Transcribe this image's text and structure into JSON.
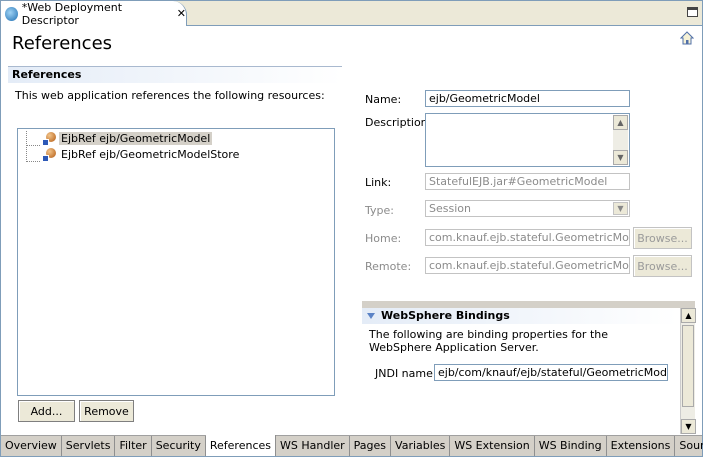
{
  "editor_tab": {
    "title": "*Web Deployment Descriptor",
    "close": "✕"
  },
  "page": {
    "title": "References"
  },
  "references_section": {
    "header": "References",
    "description": "This web application references the following resources:",
    "items": [
      {
        "label": "EjbRef ejb/GeometricModel",
        "selected": true
      },
      {
        "label": "EjbRef ejb/GeometricModelStore",
        "selected": false
      }
    ],
    "add_label": "Add...",
    "remove_label": "Remove"
  },
  "form": {
    "name_label": "Name:",
    "name_value": "ejb/GeometricModel",
    "description_label": "Description:",
    "description_value": "",
    "link_label": "Link:",
    "link_value": "StatefulEJB.jar#GeometricModel",
    "type_label": "Type:",
    "type_value": "Session",
    "home_label": "Home:",
    "home_value": "com.knauf.ejb.stateful.GeometricModelH",
    "remote_label": "Remote:",
    "remote_value": "com.knauf.ejb.stateful.GeometricModel",
    "browse_label": "Browse..."
  },
  "websphere": {
    "header": "WebSphere Bindings",
    "description": "The following are binding properties for the WebSphere Application Server.",
    "jndi_label": "JNDI name:",
    "jndi_value": "ejb/com/knauf/ejb/stateful/GeometricModelHor"
  },
  "bottom_tabs": [
    {
      "label": "Overview"
    },
    {
      "label": "Servlets"
    },
    {
      "label": "Filter"
    },
    {
      "label": "Security"
    },
    {
      "label": "References",
      "active": true
    },
    {
      "label": "WS Handler"
    },
    {
      "label": "Pages"
    },
    {
      "label": "Variables"
    },
    {
      "label": "WS Extension"
    },
    {
      "label": "WS Binding"
    },
    {
      "label": "Extensions"
    },
    {
      "label": "Source"
    }
  ]
}
